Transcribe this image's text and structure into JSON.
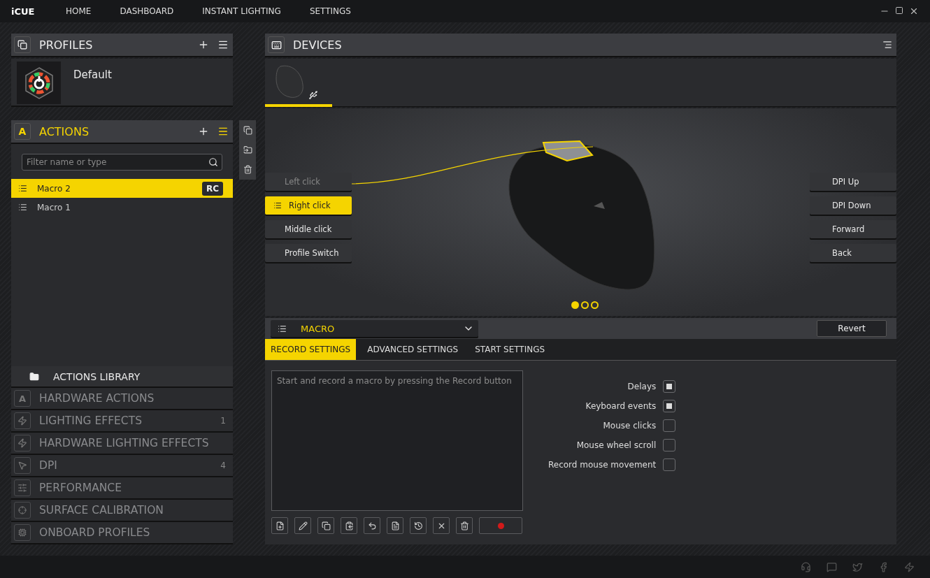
{
  "topbar": {
    "logo": "iCUE",
    "nav": [
      "HOME",
      "DASHBOARD",
      "INSTANT LIGHTING",
      "SETTINGS"
    ]
  },
  "profiles": {
    "title": "PROFILES",
    "items": [
      {
        "name": "Default"
      }
    ]
  },
  "actions": {
    "icon_letter": "A",
    "title": "ACTIONS",
    "filter_placeholder": "Filter name or type",
    "items": [
      {
        "name": "Macro 2",
        "badge": "RC",
        "selected": true
      },
      {
        "name": "Macro 1",
        "selected": false
      }
    ]
  },
  "library": [
    {
      "kind": "header",
      "label": "ACTIONS LIBRARY"
    },
    {
      "kind": "category",
      "label": "HARDWARE ACTIONS",
      "icon_letter": "A"
    },
    {
      "kind": "category",
      "label": "LIGHTING EFFECTS",
      "count": "1"
    },
    {
      "kind": "category",
      "label": "HARDWARE LIGHTING EFFECTS"
    },
    {
      "kind": "category",
      "label": "DPI",
      "count": "4"
    },
    {
      "kind": "category",
      "label": "PERFORMANCE"
    },
    {
      "kind": "category",
      "label": "SURFACE CALIBRATION"
    },
    {
      "kind": "category",
      "label": "ONBOARD PROFILES"
    }
  ],
  "devices": {
    "title": "DEVICES",
    "tabs": [
      {
        "selected": true
      }
    ]
  },
  "mouse_buttons_left": [
    {
      "label": "Left click",
      "selected": false,
      "disabled": true
    },
    {
      "label": "Right click",
      "selected": true,
      "disabled": false
    },
    {
      "label": "Middle click",
      "selected": false,
      "disabled": false
    },
    {
      "label": "Profile Switch",
      "selected": false,
      "disabled": false
    }
  ],
  "mouse_buttons_right": [
    {
      "label": "DPI Up",
      "selected": false,
      "disabled": false
    },
    {
      "label": "DPI Down",
      "selected": false,
      "disabled": false
    },
    {
      "label": "Forward",
      "selected": false,
      "disabled": false
    },
    {
      "label": "Back",
      "selected": false,
      "disabled": false
    }
  ],
  "pager": [
    {
      "selected": true
    },
    {
      "selected": false
    },
    {
      "selected": false
    }
  ],
  "macro": {
    "type": "MACRO",
    "revert": "Revert",
    "tabs": [
      {
        "label": "RECORD SETTINGS",
        "selected": true
      },
      {
        "label": "ADVANCED SETTINGS",
        "selected": false
      },
      {
        "label": "START SETTINGS",
        "selected": false
      }
    ],
    "placeholder": "Start and record a macro by pressing the Record button",
    "options": [
      {
        "label": "Delays",
        "checked": true
      },
      {
        "label": "Keyboard events",
        "checked": true
      },
      {
        "label": "Mouse clicks",
        "checked": false
      },
      {
        "label": "Mouse wheel scroll",
        "checked": false
      },
      {
        "label": "Record mouse movement",
        "checked": false
      }
    ]
  }
}
